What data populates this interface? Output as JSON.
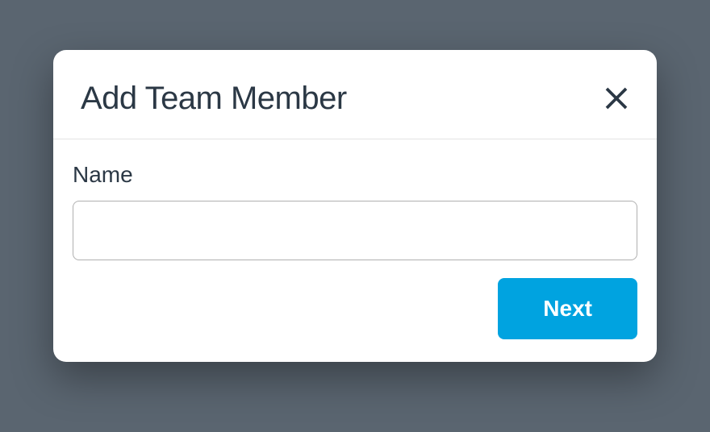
{
  "modal": {
    "title": "Add Team Member",
    "form": {
      "name_label": "Name",
      "name_value": ""
    },
    "buttons": {
      "next_label": "Next"
    }
  }
}
